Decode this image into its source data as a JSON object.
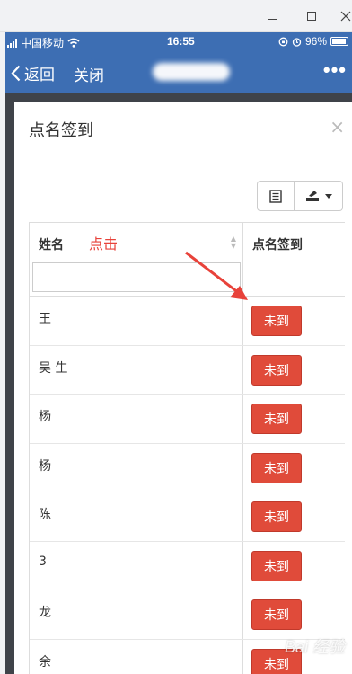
{
  "status_bar": {
    "carrier": "中国移动",
    "time": "16:55",
    "battery": "96%",
    "battery_level": 0.96
  },
  "nav_bar": {
    "back_label": "返回",
    "close_label": "关闭",
    "more_label": "•••"
  },
  "modal": {
    "title": "点名签到",
    "close_label": "×"
  },
  "table": {
    "columns": [
      "姓名",
      "点名签到"
    ],
    "filter_value": "",
    "rows": [
      {
        "name": "王",
        "status": "未到"
      },
      {
        "name": "吴  生",
        "status": "未到"
      },
      {
        "name": "杨",
        "status": "未到"
      },
      {
        "name": "杨",
        "status": "未到"
      },
      {
        "name": "陈",
        "status": "未到"
      },
      {
        "name": "3",
        "status": "未到"
      },
      {
        "name": "龙",
        "status": "未到"
      },
      {
        "name": "余",
        "status": "未到"
      }
    ]
  },
  "annotation": {
    "text": "点击",
    "color": "#e8423a"
  },
  "colors": {
    "header_blue": "#3d6eb3",
    "button_red": "#e04b3a"
  },
  "watermark": "Bai 经验"
}
